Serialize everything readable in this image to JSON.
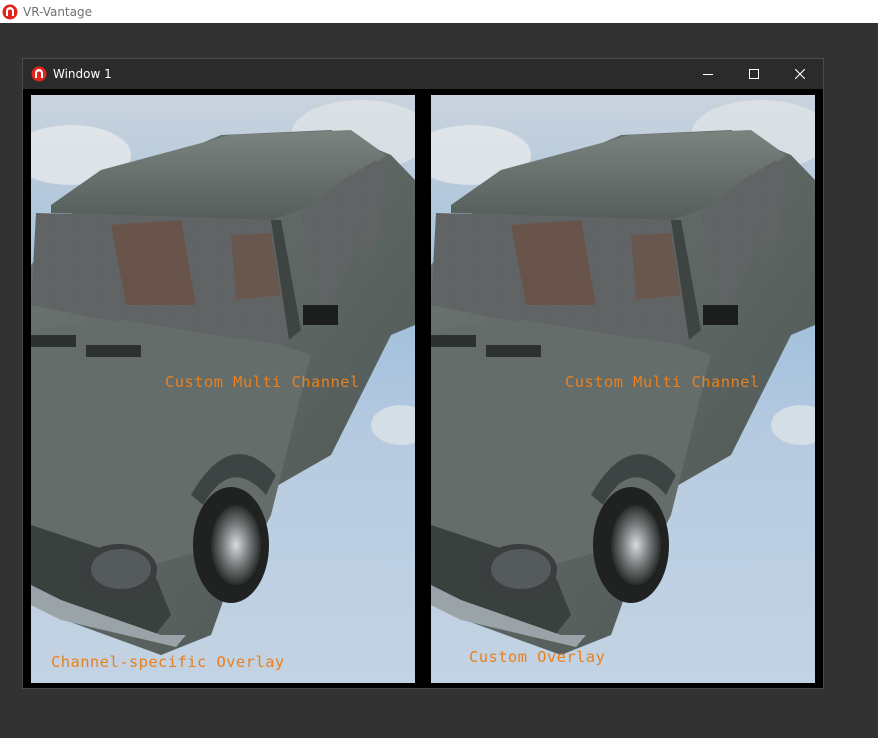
{
  "app": {
    "title": "VR-Vantage",
    "icon": "vr-vantage-logo-icon"
  },
  "window": {
    "title": "Window 1",
    "icon": "vr-vantage-logo-icon",
    "controls": {
      "minimize": "minimize-icon",
      "maximize": "maximize-icon",
      "close": "close-icon"
    }
  },
  "viewports": {
    "left": {
      "center_label": "Custom Multi Channel",
      "overlay_label": "Channel-specific Overlay"
    },
    "right": {
      "center_label": "Custom Multi Channel",
      "overlay_label": "Custom Overlay"
    }
  },
  "colors": {
    "overlay_text": "#e8801e",
    "app_bg": "#333232",
    "window_bg": "#2b2b2b",
    "logo_red": "#e0261b"
  }
}
